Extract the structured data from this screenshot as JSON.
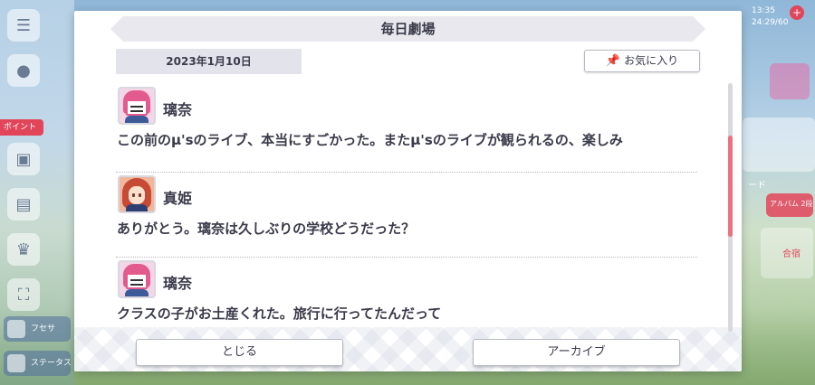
{
  "background": {
    "left_pills": [
      "フセサ",
      "ステータス アイテム"
    ],
    "left_red_badge": "ポイント",
    "status": [
      "13:35",
      "24:29/60"
    ],
    "right_labels": [
      "ード",
      "アルバム 2段",
      "合宿"
    ]
  },
  "modal": {
    "title": "毎日劇場",
    "date": "2023年1月10日",
    "favorite_label": "お気に入り",
    "entries": [
      {
        "speaker": "璃奈",
        "text": "この前のμ'sのライブ、本当にすごかった。またμ'sのライブが観られるの、楽しみ"
      },
      {
        "speaker": "真姫",
        "text": "ありがとう。璃奈は久しぶりの学校どうだった？"
      },
      {
        "speaker": "璃奈",
        "text": "クラスの子がお土産くれた。旅行に行ってたんだって"
      }
    ],
    "close_label": "とじる",
    "archive_label": "アーカイブ"
  },
  "colors": {
    "accent_scroll": "#ee6f7f",
    "title_bar": "#e8e8ee",
    "text": "#3a3a4a"
  },
  "icons": [
    "menu-icon",
    "chat-icon",
    "gift-icon",
    "trophy-icon",
    "fullscreen-icon",
    "pin-icon"
  ]
}
